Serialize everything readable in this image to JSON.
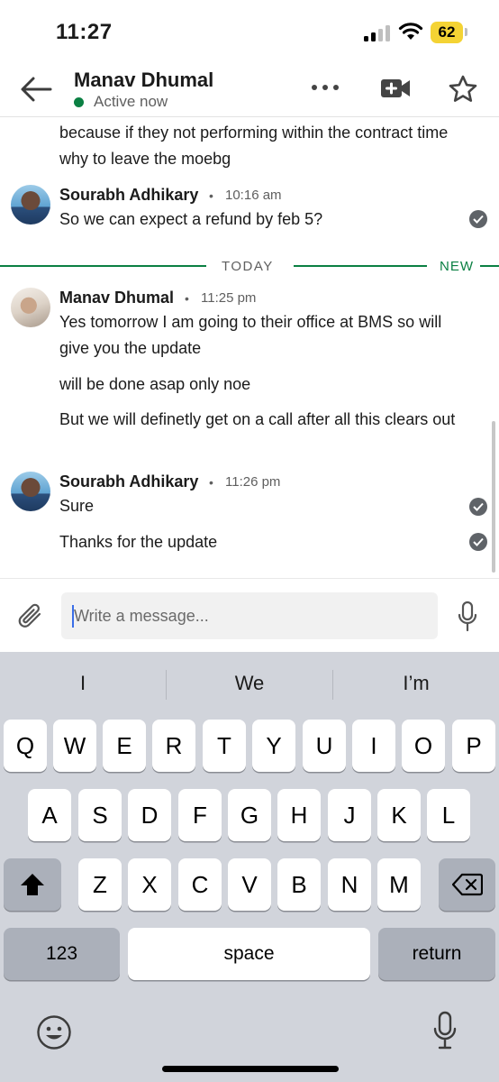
{
  "status_bar": {
    "time": "11:27",
    "battery": "62",
    "battery_color": "#f4d334"
  },
  "header": {
    "contact_name": "Manav Dhumal",
    "presence": "Active now",
    "presence_color": "#0b8043",
    "icons": [
      "back-arrow-icon",
      "more-icon",
      "video-call-icon",
      "star-icon"
    ]
  },
  "messages": {
    "continued_text": "because if they not performing within the contract time why to leave the moebg",
    "groups": [
      {
        "sender": "Sourabh Adhikary",
        "time": "10:16 am",
        "lines": [
          "So we can expect a refund by feb 5?"
        ]
      },
      {
        "sender": "Manav Dhumal",
        "time": "11:25 pm",
        "lines": [
          "Yes tomorrow I am going to their office at BMS so will give you the update",
          "will be done asap only noe",
          "But we will definetly get on a call after all this clears out"
        ]
      },
      {
        "sender": "Sourabh Adhikary",
        "time": "11:26 pm",
        "lines": [
          "Sure",
          "Thanks for the update"
        ]
      }
    ],
    "divider_label": "TODAY",
    "new_label": "NEW",
    "divider_color": "#0b8043"
  },
  "compose": {
    "placeholder": "Write a message..."
  },
  "keyboard": {
    "suggestions": [
      "I",
      "We",
      "I’m"
    ],
    "row1": [
      "Q",
      "W",
      "E",
      "R",
      "T",
      "Y",
      "U",
      "I",
      "O",
      "P"
    ],
    "row2": [
      "A",
      "S",
      "D",
      "F",
      "G",
      "H",
      "J",
      "K",
      "L"
    ],
    "row3": [
      "Z",
      "X",
      "C",
      "V",
      "B",
      "N",
      "M"
    ],
    "numbers_key": "123",
    "space_key": "space",
    "return_key": "return"
  }
}
